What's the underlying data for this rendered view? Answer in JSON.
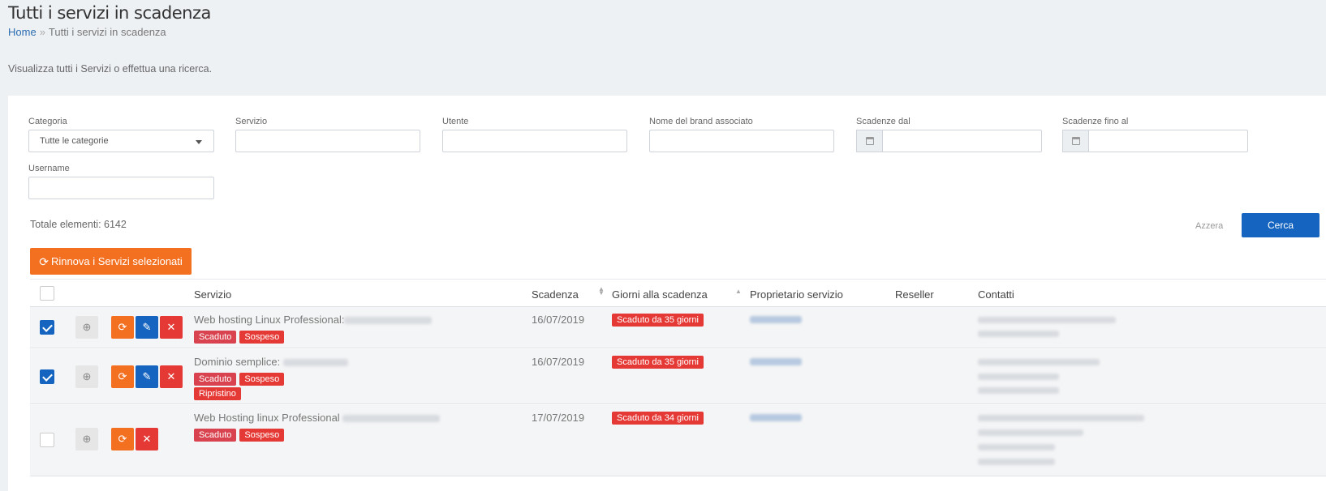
{
  "header": {
    "title": "Tutti i servizi in scadenza",
    "breadcrumb": {
      "home": "Home",
      "separator": "»",
      "current": "Tutti i servizi in scadenza"
    },
    "intro": "Visualizza tutti i Servizi o effettua una ricerca."
  },
  "filters": {
    "categoria": {
      "label": "Categoria",
      "value": "Tutte le categorie"
    },
    "servizio": {
      "label": "Servizio",
      "value": ""
    },
    "utente": {
      "label": "Utente",
      "value": ""
    },
    "brand": {
      "label": "Nome del brand associato",
      "value": ""
    },
    "scadenze_dal": {
      "label": "Scadenze dal",
      "value": ""
    },
    "scadenze_al": {
      "label": "Scadenze fino al",
      "value": ""
    },
    "username": {
      "label": "Username",
      "value": ""
    }
  },
  "summary": {
    "total": "Totale elementi: 6142"
  },
  "actions": {
    "reset": "Azzera",
    "search": "Cerca",
    "renew": "Rinnova i Servizi selezionati"
  },
  "table": {
    "columns": {
      "servizio": "Servizio",
      "scadenza": "Scadenza",
      "giorni": "Giorni alla scadenza",
      "proprietario": "Proprietario servizio",
      "reseller": "Reseller",
      "contatti": "Contatti"
    },
    "rows": [
      {
        "checked": true,
        "name": "Web hosting Linux Professional:",
        "badges": [
          "Scaduto",
          "Sospeso"
        ],
        "date": "16/07/2019",
        "days": "Scaduto da 35 giorni"
      },
      {
        "checked": true,
        "name": "Dominio semplice:",
        "badges": [
          "Scaduto",
          "Sospeso",
          "Ripristino"
        ],
        "date": "16/07/2019",
        "days": "Scaduto da 35 giorni"
      },
      {
        "checked": false,
        "name": "Web Hosting linux Professional",
        "badges": [
          "Scaduto",
          "Sospeso"
        ],
        "date": "17/07/2019",
        "days": "Scaduto da 34 giorni"
      }
    ]
  },
  "icons": {
    "zoom": "zoom-in-icon",
    "renew": "refresh-icon",
    "edit_date": "calendar-edit-icon",
    "cancel": "calendar-x-icon",
    "calendar": "calendar-icon"
  },
  "colors": {
    "primary": "#1565c0",
    "accent": "#f47021",
    "danger": "#e53935",
    "badge_scaduto": "#d9434f"
  }
}
